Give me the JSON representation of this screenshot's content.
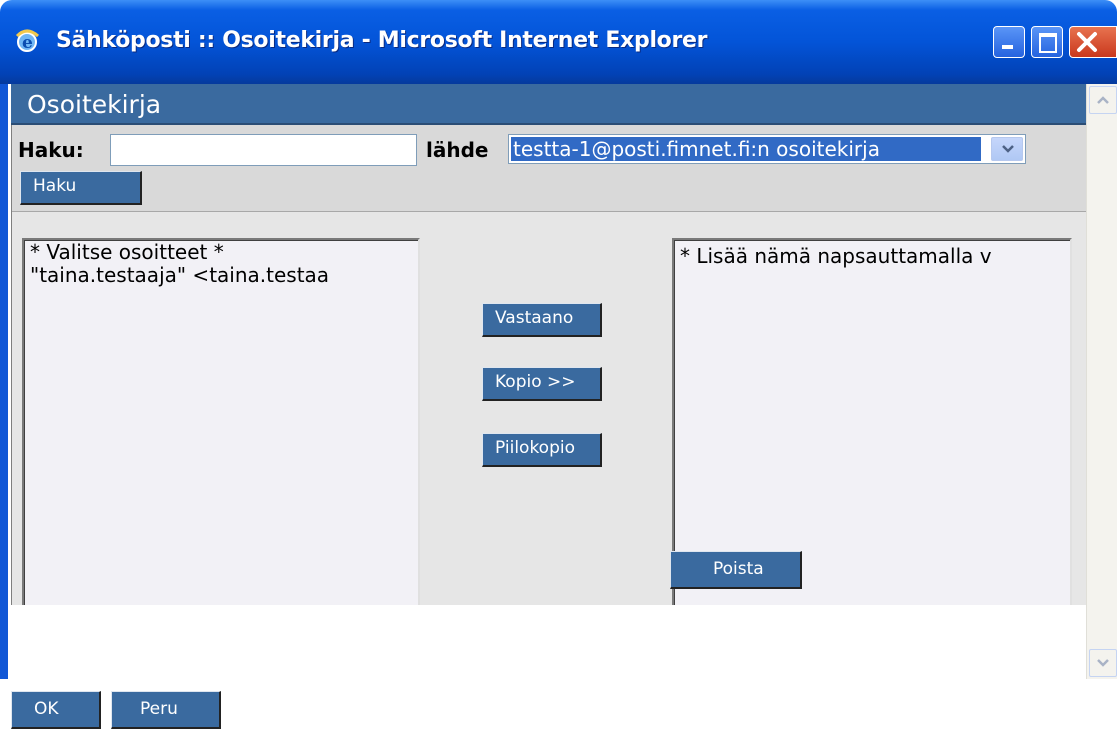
{
  "window": {
    "title": "Sähköposti :: Osoitekirja - Microsoft Internet Explorer"
  },
  "address_book": {
    "title": "Osoitekirja",
    "search_label": "Haku:",
    "search_value": "",
    "source_label": "lähde",
    "source_selected": "testta-1@posti.fimnet.fi:n osoitekirja",
    "search_button": "Haku",
    "available_list": [
      "* Valitse osoitteet *",
      "\"taina.testaaja\" <taina.testaa"
    ],
    "selected_list": [
      "* Lisää nämä napsauttamalla v"
    ],
    "to_button": "Vastaano",
    "cc_button": "Kopio >>",
    "bcc_button": "Piilokopio",
    "remove_button": "Poista",
    "ok_button": "OK",
    "cancel_button": "Peru"
  },
  "colors": {
    "titlebar": "#0354d8",
    "header": "#3a6a9f",
    "selection": "#316ac5"
  }
}
